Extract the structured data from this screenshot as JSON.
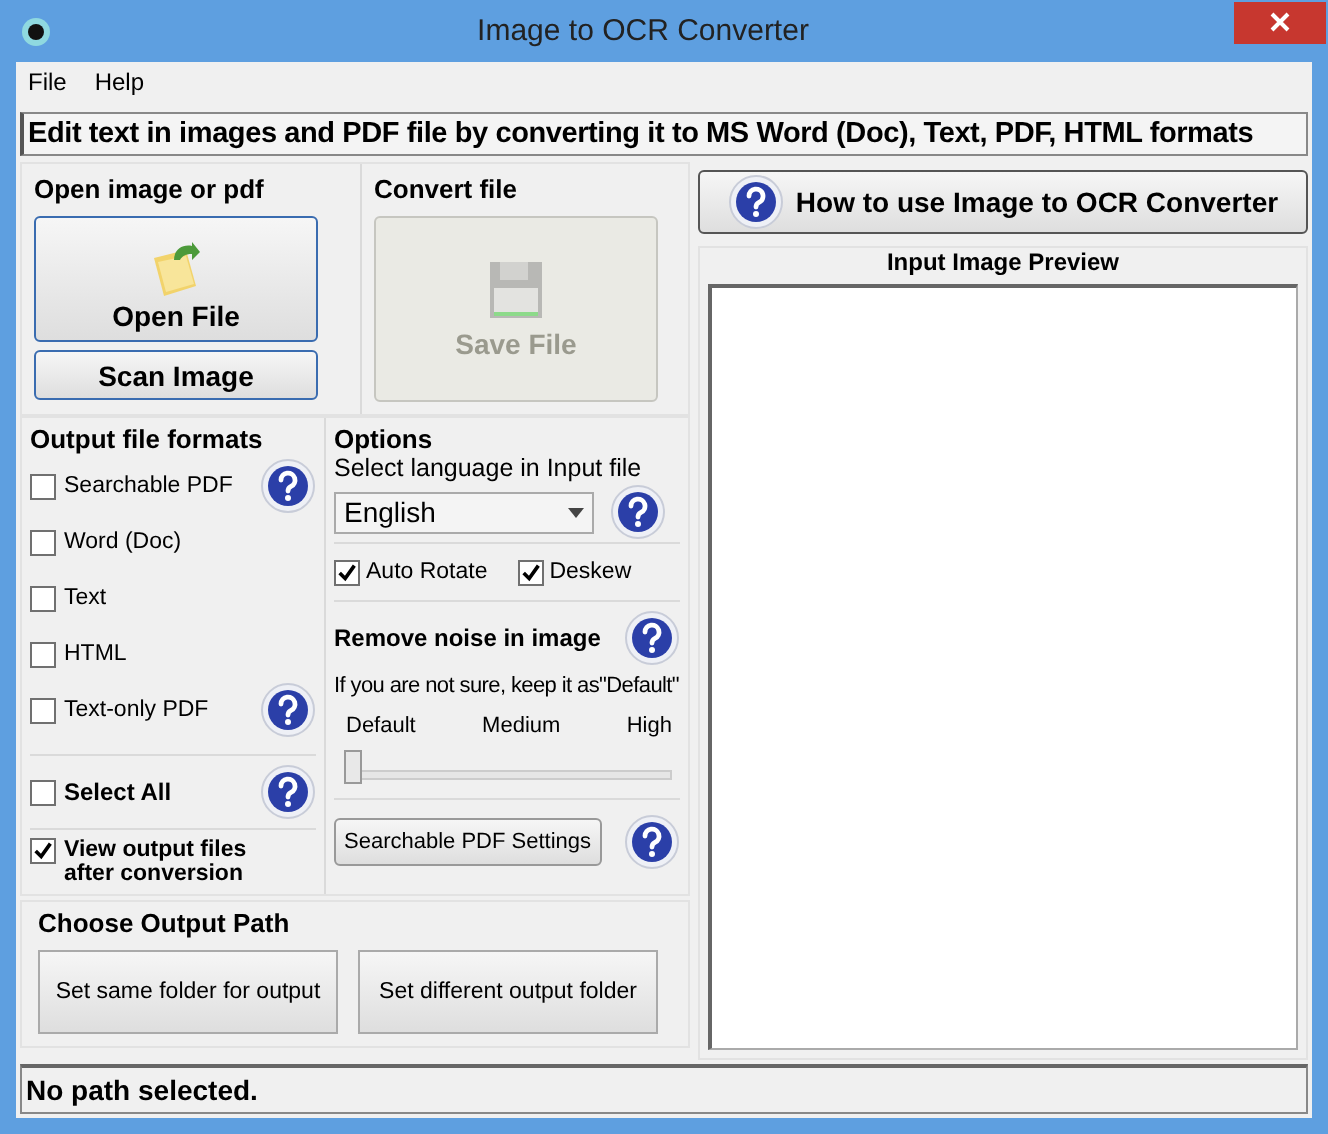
{
  "window": {
    "title": "Image to OCR Converter"
  },
  "menu": [
    {
      "label": "File"
    },
    {
      "label": "Help"
    }
  ],
  "banner": "Edit text in images and PDF file by converting it to MS Word (Doc), Text, PDF, HTML formats",
  "open_group": {
    "title": "Open image or pdf",
    "open_button": "Open File",
    "scan_button": "Scan Image"
  },
  "convert_group": {
    "title": "Convert file",
    "save_button": {
      "label": "Save File",
      "disabled": true
    }
  },
  "output_formats": {
    "title": "Output file formats",
    "items": [
      {
        "label": "Searchable PDF",
        "checked": false,
        "help": true
      },
      {
        "label": "Word (Doc)",
        "checked": false,
        "help": false
      },
      {
        "label": "Text",
        "checked": false,
        "help": false
      },
      {
        "label": "HTML",
        "checked": false,
        "help": false
      },
      {
        "label": "Text-only PDF",
        "checked": false,
        "help": true
      }
    ]
  },
  "select_all": {
    "label": "Select All",
    "checked": false
  },
  "view_output": {
    "label": "View output files after conversion",
    "checked": true
  },
  "options": {
    "title": "Options",
    "language_label": "Select language in Input file",
    "language": "English",
    "checkboxes": [
      {
        "label": "Auto Rotate",
        "checked": true
      },
      {
        "label": "Deskew",
        "checked": true
      }
    ],
    "noise_title": "Remove noise in image",
    "noise_hint": "If you are not sure, keep it as\"Default\"",
    "noise_levels": [
      "Default",
      "Medium",
      "High"
    ],
    "noise": {
      "level": 0
    },
    "pdf_settings_button": "Searchable PDF Settings"
  },
  "output_path": {
    "title": "Choose Output Path",
    "buttons": [
      "Set same folder for output",
      "Set different output folder"
    ]
  },
  "help_button": "How to use Image to OCR Converter",
  "preview": {
    "title": "Input Image Preview"
  },
  "status_bar": "No path selected."
}
